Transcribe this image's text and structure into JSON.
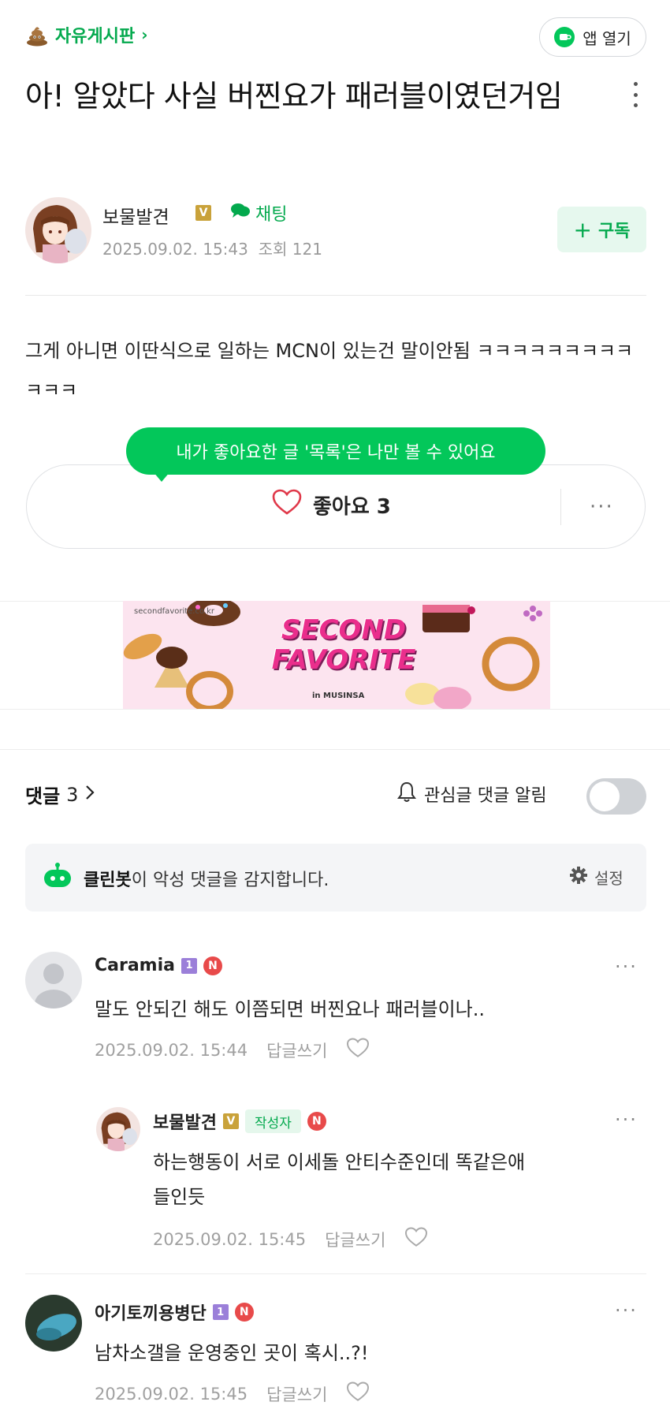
{
  "header": {
    "board_name": "자유게시판",
    "open_app_label": "앱 열기"
  },
  "post": {
    "title": "아! 알았다 사실 버찐요가 패러블이였던거임",
    "author": "보물발견",
    "author_badge": "V",
    "chat_label": "채팅",
    "date": "2025.09.02. 15:43",
    "views_label": "조회 121",
    "subscribe_label": "구독",
    "body": "그게 아니면 이딴식으로 일하는 MCN이 있는건 말이안됨 ㅋㅋㅋㅋㅋㅋㅋㅋㅋㅋㅋㅋ"
  },
  "like": {
    "label": "좋아요 3",
    "tooltip": "내가 좋아요한 글 '목록'은 나만 볼 수 있어요"
  },
  "ad": {
    "domain": "secondfavorite.co.kr",
    "title": "SECOND FAVORITE",
    "subtitle": "in MUSINSA"
  },
  "comments_section": {
    "label": "댓글",
    "count": "3",
    "notify_label": "관심글 댓글 알림",
    "cleanbot_name": "클린봇",
    "cleanbot_text": "이 악성 댓글을 감지합니다.",
    "settings_label": "설정"
  },
  "comments": [
    {
      "author": "Caramia",
      "level": "1",
      "badge": "N",
      "text": "말도 안되긴 해도 이쯤되면 버찐요나 패러블이나..",
      "date": "2025.09.02. 15:44",
      "reply_label": "답글쓰기"
    },
    {
      "author": "보물발견",
      "level": "V",
      "writer_label": "작성자",
      "badge": "N",
      "text_line1": "하는행동이 서로 이세돌 안티수준인데 똑같은애",
      "text_line2": "들인듯",
      "date": "2025.09.02. 15:45",
      "reply_label": "답글쓰기"
    },
    {
      "author": "아기토끼용병단",
      "level": "1",
      "badge": "N",
      "text": "남차소갤을 운영중인 곳이 혹시..?!",
      "date": "2025.09.02. 15:45",
      "reply_label": "답글쓰기"
    }
  ],
  "colors": {
    "accent_green": "#03c75a",
    "green_text": "#03a94d",
    "level_badge": "#9b7fd9",
    "new_badge": "#e84a4a"
  },
  "icons": [
    "poop-icon",
    "cup-icon",
    "kebab-menu-icon",
    "chat-bubble-icon",
    "plus-icon",
    "heart-icon",
    "more-icon",
    "chevron-right-icon",
    "bell-icon",
    "cleanbot-icon",
    "gear-icon",
    "default-avatar-icon"
  ]
}
